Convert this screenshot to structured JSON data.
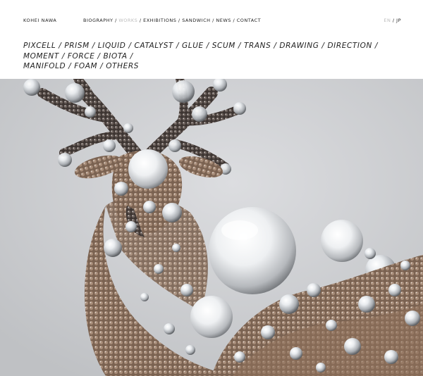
{
  "site": {
    "name": "KOHEI NAWA"
  },
  "nav": {
    "items": [
      {
        "label": "BIOGRAPHY",
        "active": false
      },
      {
        "label": "WORKS",
        "active": true
      },
      {
        "label": "EXHIBITIONS",
        "active": false
      },
      {
        "label": "SANDWICH",
        "active": false
      },
      {
        "label": "NEWS",
        "active": false
      },
      {
        "label": "CONTACT",
        "active": false
      }
    ],
    "separator": " / "
  },
  "lang": {
    "en": "EN",
    "jp": "JP",
    "separator": " / "
  },
  "series": {
    "separator": " / ",
    "items": [
      "PIXCELL",
      "PRISM",
      "LIQUID",
      "CATALYST",
      "GLUE",
      "SCUM",
      "TRANS",
      "DRAWING",
      "DIRECTION",
      "MOMENT",
      "FORCE",
      "BIOTA",
      "MANIFOLD",
      "FOAM",
      "OTHERS"
    ]
  },
  "colors": {
    "text": "#222222",
    "dim": "#bcbcbc",
    "background": "#ffffff",
    "photo_bg": "#cfd0d2"
  }
}
